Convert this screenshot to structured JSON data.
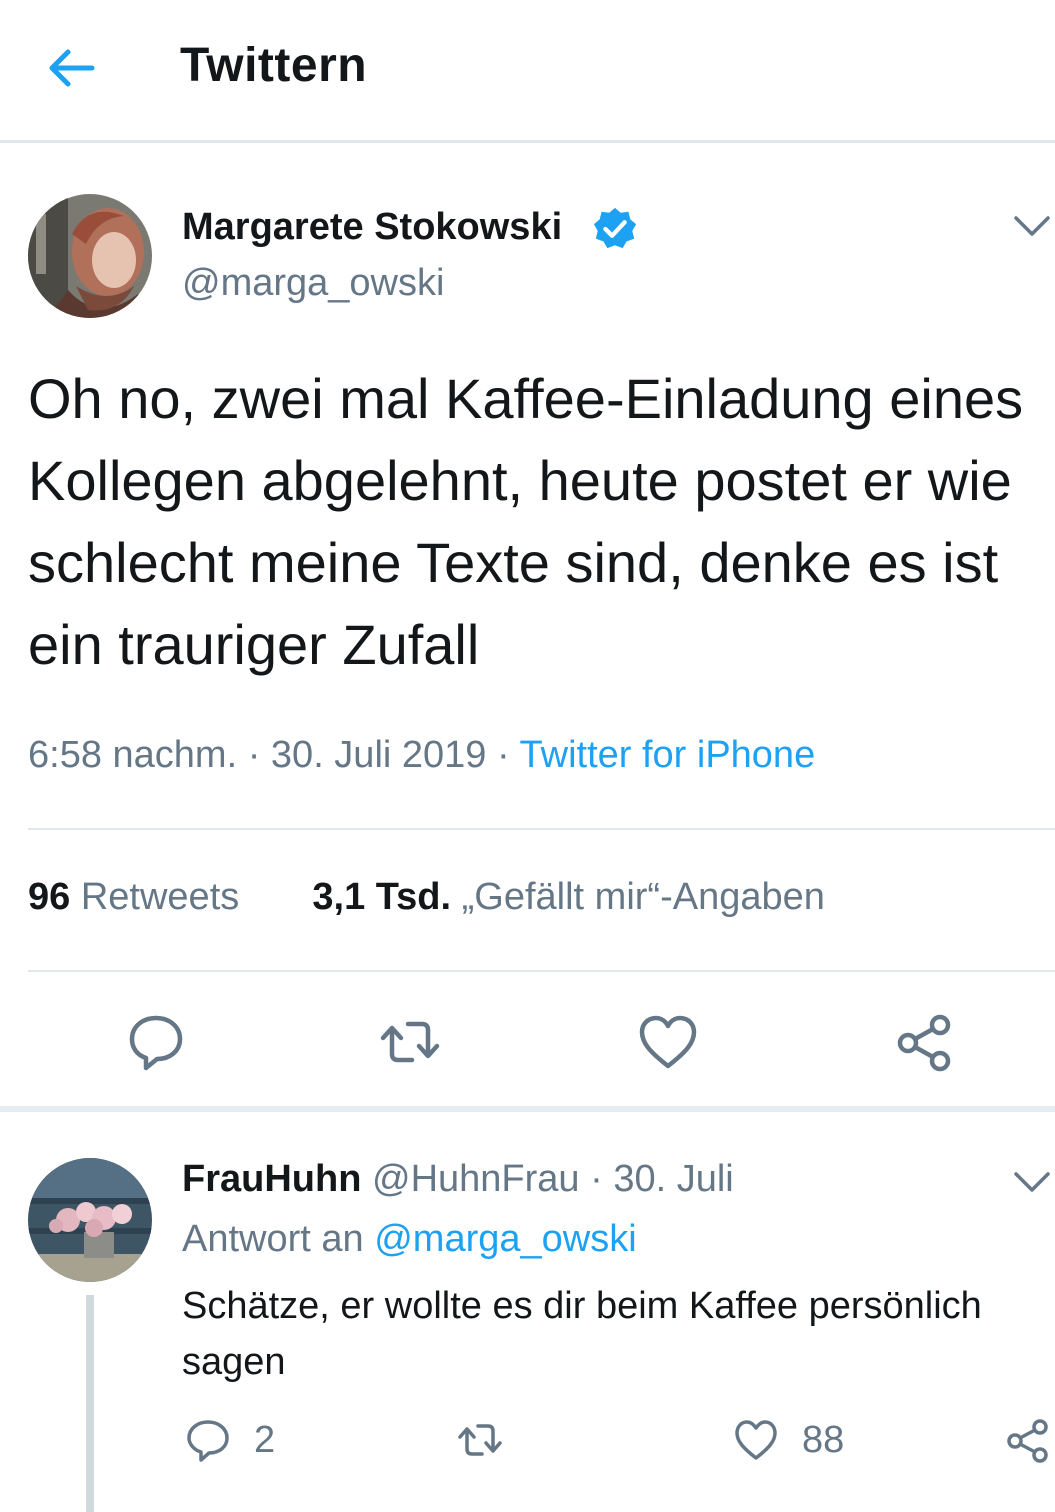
{
  "header": {
    "title": "Twittern",
    "back_icon": "arrow-left-icon"
  },
  "tweet": {
    "author_name": "Margarete Stokowski",
    "verified_icon": "verified-badge-icon",
    "handle": "@marga_owski",
    "text": "Oh no, zwei mal Kaffee-Einladung eines Kollegen abgelehnt, heute postet er wie schlecht meine Texte sind, denke es ist ein trauriger Zufall",
    "time": "6:58 nachm.",
    "date": "30. Juli 2019",
    "source": "Twitter for iPhone",
    "sep": "·",
    "retweets_count": "96",
    "retweets_label": "Retweets",
    "likes_count": "3,1 Tsd.",
    "likes_label": "„Gefällt mir“-Angaben"
  },
  "reply": {
    "author_name": "FrauHuhn",
    "handle": "@HuhnFrau",
    "sep": "·",
    "date": "30. Juli",
    "reply_to_label": "Antwort an",
    "reply_to_handle": "@marga_owski",
    "text": "Schätze, er wollte es dir beim Kaffee persönlich sagen",
    "reply_count": "2",
    "like_count": "88"
  },
  "colors": {
    "accent": "#1da1f2",
    "secondary_text": "#657786",
    "divider": "#e1e8ed"
  }
}
